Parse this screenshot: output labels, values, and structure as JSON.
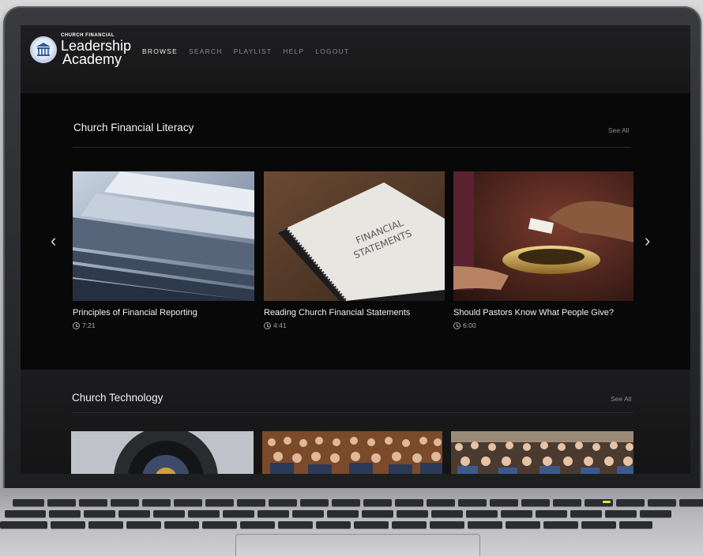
{
  "brand": {
    "small": "CHURCH FINANCIAL",
    "line1": "Leadership",
    "line2": "Academy"
  },
  "nav": [
    {
      "label": "BROWSE",
      "active": true
    },
    {
      "label": "SEARCH",
      "active": false
    },
    {
      "label": "PLAYLIST",
      "active": false
    },
    {
      "label": "HELP",
      "active": false
    },
    {
      "label": "LOGOUT",
      "active": false
    }
  ],
  "sections": [
    {
      "title": "Church Financial Literacy",
      "see_all": "See All",
      "videos": [
        {
          "title": "Principles of Financial Reporting",
          "duration": "7:21",
          "thumb_icon": "annual-report-binders-image"
        },
        {
          "title": "Reading Church Financial Statements",
          "duration": "4:41",
          "thumb_icon": "financial-statements-book-image"
        },
        {
          "title": "Should Pastors Know What People Give?",
          "duration": "6:00",
          "thumb_icon": "offering-plate-image"
        }
      ]
    },
    {
      "title": "Church Technology",
      "see_all": "See All",
      "videos": [
        {
          "thumb_icon": "camera-lens-image"
        },
        {
          "thumb_icon": "audience-image"
        },
        {
          "thumb_icon": "congregation-image"
        }
      ]
    }
  ],
  "colors": {
    "background": "#0b0b0c",
    "text": "#f2f2f2",
    "muted": "#8a8a8c"
  }
}
